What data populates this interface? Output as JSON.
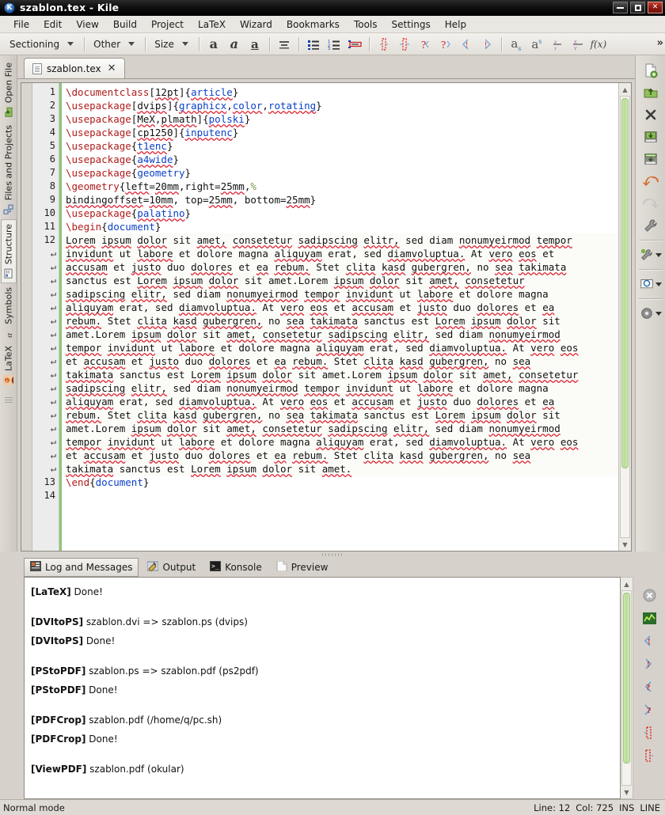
{
  "window": {
    "title": "szablon.tex - Kile",
    "icon": "kile-app-icon",
    "buttons": {
      "minimize": "minimize-icon",
      "maximize": "maximize-icon",
      "close": "close-icon"
    }
  },
  "menubar": {
    "items": [
      {
        "label": "File",
        "accel": "F"
      },
      {
        "label": "Edit",
        "accel": "E"
      },
      {
        "label": "View",
        "accel": "V"
      },
      {
        "label": "Build",
        "accel": "u"
      },
      {
        "label": "Project",
        "accel": "j"
      },
      {
        "label": "LaTeX",
        "accel": "X"
      },
      {
        "label": "Wizard",
        "accel": "W"
      },
      {
        "label": "Bookmarks",
        "accel": "B"
      },
      {
        "label": "Tools",
        "accel": "T"
      },
      {
        "label": "Settings",
        "accel": "S"
      },
      {
        "label": "Help",
        "accel": "H"
      }
    ]
  },
  "toolbar": {
    "combos": [
      {
        "label": "Sectioning"
      },
      {
        "label": "Other"
      },
      {
        "label": "Size"
      }
    ],
    "buttons": [
      {
        "name": "bold-icon",
        "glyph": "a"
      },
      {
        "name": "italic-icon",
        "glyph": "a"
      },
      {
        "name": "underline-icon",
        "glyph": "a"
      },
      {
        "name": "center-align-icon",
        "glyph": "≡"
      },
      {
        "name": "bullet-list-icon",
        "glyph": "•"
      },
      {
        "name": "numbered-list-icon",
        "glyph": "1"
      },
      {
        "name": "description-list-icon",
        "glyph": "▭"
      },
      {
        "name": "tabular-left-icon",
        "glyph": "I"
      },
      {
        "name": "tabular-right-icon",
        "glyph": "I"
      },
      {
        "name": "quote-left-icon",
        "glyph": "?"
      },
      {
        "name": "quote-right-icon",
        "glyph": "?"
      },
      {
        "name": "angle-left-icon",
        "glyph": "‹"
      },
      {
        "name": "angle-right-icon",
        "glyph": "›"
      },
      {
        "name": "subscript-icon",
        "glyph": "a"
      },
      {
        "name": "superscript-icon",
        "glyph": "a"
      },
      {
        "name": "fraction-icon",
        "glyph": "x/y"
      },
      {
        "name": "dfrac-icon",
        "glyph": "x/y"
      },
      {
        "name": "function-icon",
        "glyph": "f(x)"
      }
    ],
    "overflow_label": "»"
  },
  "sidebar": {
    "tabs": [
      {
        "label": "Open File",
        "icon": "open-file-icon",
        "selected": false
      },
      {
        "label": "Files and Projects",
        "icon": "projects-icon",
        "selected": false
      },
      {
        "label": "Structure",
        "icon": "structure-icon",
        "selected": true
      },
      {
        "label": "Symbols",
        "icon": "symbols-icon",
        "selected": false
      },
      {
        "label": "LaTeX",
        "icon": "latex-icon",
        "selected": false
      }
    ]
  },
  "document_tab": {
    "label": "szablon.tex",
    "icon": "tex-file-icon",
    "close_label": "✕"
  },
  "editor": {
    "fold_line": 11,
    "lines": [
      {
        "num": "1",
        "type": "code",
        "segments": [
          {
            "t": "\\documentclass",
            "c": "cmd"
          },
          {
            "t": "[",
            "c": "p"
          },
          {
            "t": "12pt",
            "c": "sp"
          },
          {
            "t": "]{",
            "c": "p"
          },
          {
            "t": "article",
            "c": "arg sp"
          },
          {
            "t": "}",
            "c": "p"
          }
        ]
      },
      {
        "num": "2",
        "type": "code",
        "segments": [
          {
            "t": "\\usepackage",
            "c": "cmd"
          },
          {
            "t": "[",
            "c": "p"
          },
          {
            "t": "dvips",
            "c": "sp"
          },
          {
            "t": "]{",
            "c": "p"
          },
          {
            "t": "graphicx",
            "c": "arg sp"
          },
          {
            "t": ",",
            "c": "p"
          },
          {
            "t": "color",
            "c": "arg sp"
          },
          {
            "t": ",",
            "c": "p"
          },
          {
            "t": "rotating",
            "c": "arg sp"
          },
          {
            "t": "}",
            "c": "p"
          }
        ]
      },
      {
        "num": "3",
        "type": "code",
        "segments": [
          {
            "t": "\\usepackage",
            "c": "cmd"
          },
          {
            "t": "[",
            "c": "p"
          },
          {
            "t": "MeX",
            "c": "sp"
          },
          {
            "t": ",",
            "c": "p"
          },
          {
            "t": "plmath",
            "c": "sp"
          },
          {
            "t": "]{",
            "c": "p"
          },
          {
            "t": "polski",
            "c": "arg sp"
          },
          {
            "t": "}",
            "c": "p"
          }
        ]
      },
      {
        "num": "4",
        "type": "code",
        "segments": [
          {
            "t": "\\usepackage",
            "c": "cmd"
          },
          {
            "t": "[",
            "c": "p"
          },
          {
            "t": "cp1250",
            "c": "sp"
          },
          {
            "t": "]{",
            "c": "p"
          },
          {
            "t": "inputenc",
            "c": "arg sp"
          },
          {
            "t": "}",
            "c": "p"
          }
        ]
      },
      {
        "num": "5",
        "type": "code",
        "segments": [
          {
            "t": "\\usepackage",
            "c": "cmd"
          },
          {
            "t": "{",
            "c": "p"
          },
          {
            "t": "t1enc",
            "c": "arg sp"
          },
          {
            "t": "}",
            "c": "p"
          }
        ]
      },
      {
        "num": "6",
        "type": "code",
        "segments": [
          {
            "t": "\\usepackage",
            "c": "cmd"
          },
          {
            "t": "{",
            "c": "p"
          },
          {
            "t": "a4wide",
            "c": "arg sp"
          },
          {
            "t": "}",
            "c": "p"
          }
        ]
      },
      {
        "num": "7",
        "type": "code",
        "segments": [
          {
            "t": "\\usepackage",
            "c": "cmd"
          },
          {
            "t": "{",
            "c": "p"
          },
          {
            "t": "geometry",
            "c": "arg"
          },
          {
            "t": "}",
            "c": "p"
          }
        ]
      },
      {
        "num": "8",
        "type": "code",
        "segments": [
          {
            "t": "\\geometry",
            "c": "cmd"
          },
          {
            "t": "{",
            "c": "p"
          },
          {
            "t": "left",
            "c": "sp"
          },
          {
            "t": "=",
            "c": "p"
          },
          {
            "t": "20mm",
            "c": "sp"
          },
          {
            "t": ",right",
            "c": "p"
          },
          {
            "t": "=",
            "c": "p"
          },
          {
            "t": "25mm",
            "c": "sp"
          },
          {
            "t": ",",
            "c": "p"
          },
          {
            "t": "%",
            "c": "pct"
          }
        ]
      },
      {
        "num": "9",
        "type": "code",
        "segments": [
          {
            "t": "bindingoffset",
            "c": "sp"
          },
          {
            "t": "=",
            "c": "p"
          },
          {
            "t": "10mm",
            "c": "sp"
          },
          {
            "t": ", top",
            "c": "p"
          },
          {
            "t": "=",
            "c": "p"
          },
          {
            "t": "25mm",
            "c": "sp"
          },
          {
            "t": ", bottom",
            "c": "p"
          },
          {
            "t": "=",
            "c": "p"
          },
          {
            "t": "25mm",
            "c": "sp"
          },
          {
            "t": "}",
            "c": "p"
          }
        ]
      },
      {
        "num": "10",
        "type": "code",
        "segments": [
          {
            "t": "\\usepackage",
            "c": "cmd"
          },
          {
            "t": "{",
            "c": "p"
          },
          {
            "t": "palatino",
            "c": "arg sp"
          },
          {
            "t": "}",
            "c": "p"
          }
        ]
      },
      {
        "num": "11",
        "type": "code",
        "segments": [
          {
            "t": "\\begin",
            "c": "cmd"
          },
          {
            "t": "{",
            "c": "p"
          },
          {
            "t": "document",
            "c": "arg"
          },
          {
            "t": "}",
            "c": "p"
          }
        ]
      },
      {
        "num": "12",
        "type": "body",
        "text": "Lorem ipsum dolor sit amet, consetetur sadipscing elitr, sed diam nonumyeirmod tempor"
      },
      {
        "num": "↵",
        "type": "body",
        "text": "invidunt ut labore et dolore magna aliquyam erat, sed diamvoluptua. At vero eos et"
      },
      {
        "num": "↵",
        "type": "body",
        "text": "accusam et justo duo dolores et ea rebum. Stet clita kasd gubergren, no sea takimata"
      },
      {
        "num": "↵",
        "type": "body",
        "text": "sanctus est Lorem ipsum dolor sit amet.Lorem ipsum dolor sit amet, consetetur"
      },
      {
        "num": "↵",
        "type": "body",
        "text": "sadipscing elitr, sed diam nonumyeirmod tempor invidunt ut labore et dolore magna"
      },
      {
        "num": "↵",
        "type": "body",
        "text": "aliquyam erat, sed diamvoluptua. At vero eos et accusam et justo duo dolores et ea"
      },
      {
        "num": "↵",
        "type": "body",
        "text": "rebum. Stet clita kasd gubergren, no sea takimata sanctus est Lorem ipsum dolor sit"
      },
      {
        "num": "↵",
        "type": "body",
        "text": "amet.Lorem ipsum dolor sit amet, consetetur sadipscing elitr, sed diam nonumyeirmod"
      },
      {
        "num": "↵",
        "type": "body",
        "text": "tempor invidunt ut labore et dolore magna aliquyam erat, sed diamvoluptua. At vero eos"
      },
      {
        "num": "↵",
        "type": "body",
        "text": "et accusam et justo duo dolores et ea rebum. Stet clita kasd gubergren, no sea"
      },
      {
        "num": "↵",
        "type": "body",
        "text": "takimata sanctus est Lorem ipsum dolor sit amet.Lorem ipsum dolor sit amet, consetetur"
      },
      {
        "num": "↵",
        "type": "body",
        "text": "sadipscing elitr, sed diam nonumyeirmod tempor invidunt ut labore et dolore magna"
      },
      {
        "num": "↵",
        "type": "body",
        "text": "aliquyam erat, sed diamvoluptua. At vero eos et accusam et justo duo dolores et ea"
      },
      {
        "num": "↵",
        "type": "body",
        "text": "rebum. Stet clita kasd gubergren, no sea takimata sanctus est Lorem ipsum dolor sit"
      },
      {
        "num": "↵",
        "type": "body",
        "text": "amet.Lorem ipsum dolor sit amet, consetetur sadipscing elitr, sed diam nonumyeirmod"
      },
      {
        "num": "↵",
        "type": "body",
        "text": "tempor invidunt ut labore et dolore magna aliquyam erat, sed diamvoluptua. At vero eos"
      },
      {
        "num": "↵",
        "type": "body",
        "text": "et accusam et justo duo dolores et ea rebum. Stet clita kasd gubergren, no sea"
      },
      {
        "num": "↵",
        "type": "body",
        "text": "takimata sanctus est Lorem ipsum dolor sit amet."
      },
      {
        "num": "13",
        "type": "code",
        "segments": [
          {
            "t": "\\end",
            "c": "cmd"
          },
          {
            "t": "{",
            "c": "p"
          },
          {
            "t": "document",
            "c": "arg"
          },
          {
            "t": "}",
            "c": "p"
          }
        ]
      },
      {
        "num": "14",
        "type": "code",
        "segments": []
      }
    ]
  },
  "right_toolbar": {
    "buttons": [
      {
        "name": "new-file-icon",
        "has_menu": false
      },
      {
        "name": "open-file-icon",
        "has_menu": false
      },
      {
        "name": "close-file-icon",
        "has_menu": false
      },
      {
        "name": "save-icon",
        "has_menu": false
      },
      {
        "name": "save-all-icon",
        "has_menu": false
      },
      {
        "name": "undo-icon",
        "has_menu": false
      },
      {
        "name": "redo-icon",
        "has_menu": false
      },
      {
        "name": "build-icon",
        "has_menu": false
      },
      {
        "name": "quickbuild-icon",
        "has_menu": true
      },
      {
        "name": "viewpdf-icon",
        "has_menu": true
      },
      {
        "name": "settings-icon",
        "has_menu": true
      }
    ]
  },
  "log_panel": {
    "tabs": [
      {
        "label": "Log and Messages",
        "icon": "log-icon",
        "selected": true
      },
      {
        "label": "Output",
        "icon": "output-icon",
        "selected": false
      },
      {
        "label": "Konsole",
        "icon": "konsole-icon",
        "selected": false
      },
      {
        "label": "Preview",
        "icon": "preview-icon",
        "selected": false
      }
    ],
    "messages": [
      {
        "tag": "[LaTeX]",
        "text": "Done!",
        "gap": false
      },
      {
        "tag": "[DVItoPS]",
        "text": "szablon.dvi => szablon.ps (dvips)",
        "gap": true
      },
      {
        "tag": "[DVItoPS]",
        "text": "Done!",
        "gap": false
      },
      {
        "tag": "[PStoPDF]",
        "text": "szablon.ps => szablon.pdf (ps2pdf)",
        "gap": true
      },
      {
        "tag": "[PStoPDF]",
        "text": "Done!",
        "gap": false
      },
      {
        "tag": "[PDFCrop]",
        "text": "szablon.pdf (/home/q/pc.sh)",
        "gap": true
      },
      {
        "tag": "[PDFCrop]",
        "text": "Done!",
        "gap": false
      },
      {
        "tag": "[ViewPDF]",
        "text": "szablon.pdf (okular)",
        "gap": true
      }
    ],
    "side_buttons": [
      {
        "name": "close-log-icon"
      },
      {
        "name": "view-log-icon"
      },
      {
        "name": "previous-error-icon"
      },
      {
        "name": "next-error-icon"
      },
      {
        "name": "previous-warning-icon"
      },
      {
        "name": "next-warning-icon"
      },
      {
        "name": "previous-badbox-icon"
      },
      {
        "name": "next-badbox-icon"
      }
    ]
  },
  "statusbar": {
    "mode": "Normal mode",
    "line_label": "Line: 12",
    "col_label": "Col: 725",
    "insert_label": "INS",
    "selection_label": "LINE"
  },
  "colors": {
    "command": "#b01a1a",
    "argument": "#0b40c8",
    "comment": "#7a9a3f",
    "scroll_thumb": "#b9dd97",
    "modified_bar": "#8fc47a",
    "spell_underline": "#dd2233"
  }
}
